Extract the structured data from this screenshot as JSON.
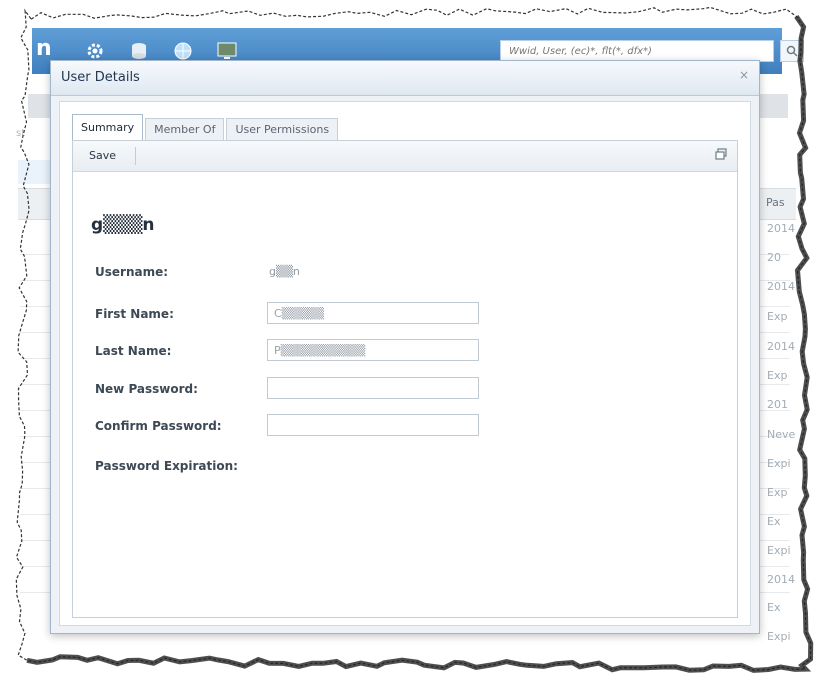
{
  "app": {
    "brand": "n",
    "search_placeholder": "Wwid, User, (ec)*, flt(*, dfx*)",
    "bg_left_label": "st",
    "icons": [
      "gear-icon",
      "database-icon",
      "globe-icon",
      "monitor-icon",
      "search-icon"
    ],
    "column_header": "Pas",
    "column_values": [
      "2014",
      "20",
      "2014",
      "Exp",
      "2014",
      "Exp",
      "201",
      "Neve",
      "Expi",
      "Exp",
      "Ex",
      "Expi",
      "2014",
      "Ex",
      "Expi"
    ]
  },
  "dialog": {
    "title": "User Details",
    "close_label": "×",
    "tabs": [
      {
        "label": "Summary",
        "active": true
      },
      {
        "label": "Member Of",
        "active": false
      },
      {
        "label": "User Permissions",
        "active": false
      }
    ],
    "toolbar": {
      "save_label": "Save"
    },
    "user_heading": "g▒▒▒n",
    "form": {
      "username": {
        "label": "Username:",
        "value": "g▒▒n"
      },
      "first_name": {
        "label": "First Name:",
        "value": "C▒▒▒▒▒"
      },
      "last_name": {
        "label": "Last Name:",
        "value": "P▒▒▒▒▒▒▒▒▒▒"
      },
      "new_password": {
        "label": "New Password:",
        "value": ""
      },
      "confirm_password": {
        "label": "Confirm Password:",
        "value": ""
      },
      "password_expiration": {
        "label": "Password Expiration:"
      }
    }
  }
}
